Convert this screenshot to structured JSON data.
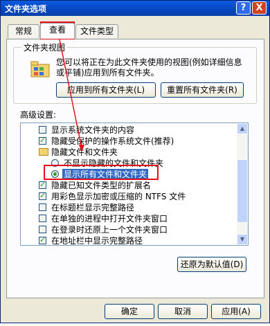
{
  "window": {
    "title": "文件夹选项",
    "help_glyph": "?",
    "close_glyph": "X"
  },
  "tabs": [
    {
      "label": "常规",
      "active": false
    },
    {
      "label": "查看",
      "active": true
    },
    {
      "label": "文件类型",
      "active": false
    }
  ],
  "folder_views": {
    "group_label": "文件夹视图",
    "description": "您可以将正在为此文件夹使用的视图(例如详细信息或平铺)应用到所有文件夹。",
    "apply_all_label": "应用到所有文件夹(L)",
    "reset_all_label": "重置所有文件夹(R)"
  },
  "advanced": {
    "label": "高级设置:",
    "items": [
      {
        "kind": "checkbox",
        "checked": false,
        "text": "显示系统文件夹的内容"
      },
      {
        "kind": "checkbox",
        "checked": true,
        "text": "隐藏受保护的操作系统文件(推荐)"
      },
      {
        "kind": "folder",
        "text": "隐藏文件和文件夹"
      },
      {
        "kind": "radio",
        "checked": false,
        "text": "不显示隐藏的文件和文件夹"
      },
      {
        "kind": "radio",
        "checked": true,
        "text": "显示所有文件和文件夹",
        "selected": true
      },
      {
        "kind": "checkbox",
        "checked": true,
        "text": "隐藏已知文件类型的扩展名"
      },
      {
        "kind": "checkbox",
        "checked": true,
        "text": "用彩色显示加密或压缩的 NTFS 文件"
      },
      {
        "kind": "checkbox",
        "checked": false,
        "text": "在标题栏显示完整路径"
      },
      {
        "kind": "checkbox",
        "checked": false,
        "text": "在单独的进程中打开文件夹窗口"
      },
      {
        "kind": "checkbox",
        "checked": false,
        "text": "在登录时还原上一个文件夹窗口"
      },
      {
        "kind": "checkbox",
        "checked": true,
        "text": "在地址栏中显示完整路径"
      }
    ],
    "restore_defaults_label": "还原为默认值(D)"
  },
  "footer": {
    "ok_label": "确定",
    "cancel_label": "取消",
    "apply_label": "应用(A)"
  },
  "accent_colors": {
    "highlight": "#e2111a",
    "title_bar": "#0646c0"
  }
}
